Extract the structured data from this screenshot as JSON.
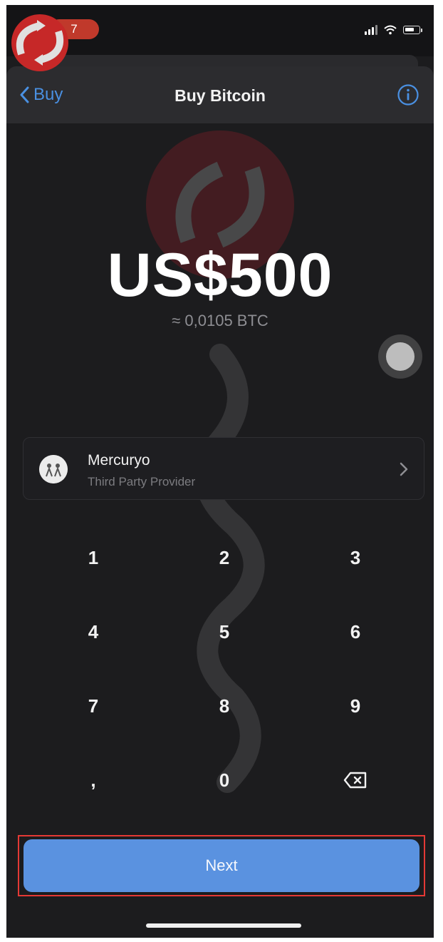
{
  "status_bar": {
    "time": "7"
  },
  "nav": {
    "back_label": "Buy",
    "title": "Buy Bitcoin"
  },
  "amount": {
    "fiat": "US$500",
    "crypto": "≈ 0,0105 BTC"
  },
  "provider": {
    "name": "Mercuryo",
    "subtitle": "Third Party Provider"
  },
  "keypad": {
    "keys": [
      "1",
      "2",
      "3",
      "4",
      "5",
      "6",
      "7",
      "8",
      "9",
      ",",
      "0"
    ]
  },
  "actions": {
    "next_label": "Next"
  },
  "colors": {
    "accent": "#4a90e2",
    "button": "#5a92e0",
    "highlight": "#e53935",
    "background": "#1c1c1e"
  },
  "icons": {
    "back": "chevron-left-icon",
    "info": "info-circle-icon",
    "provider_chevron": "chevron-right-icon",
    "delete": "backspace-icon"
  }
}
